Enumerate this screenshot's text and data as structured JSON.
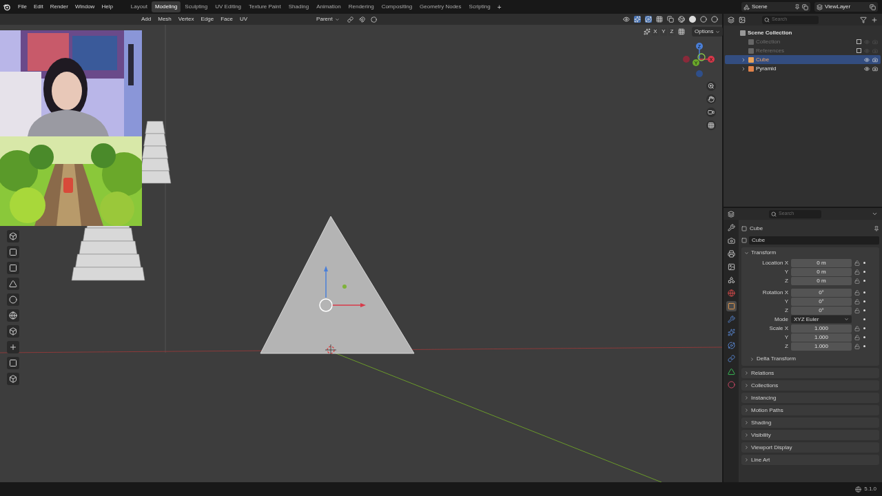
{
  "menu": [
    "File",
    "Edit",
    "Render",
    "Window",
    "Help"
  ],
  "workspaces": [
    {
      "label": "Layout",
      "selected": false
    },
    {
      "label": "Modeling",
      "selected": true
    },
    {
      "label": "Sculpting",
      "selected": false
    },
    {
      "label": "UV Editing",
      "selected": false
    },
    {
      "label": "Texture Paint",
      "selected": false
    },
    {
      "label": "Shading",
      "selected": false
    },
    {
      "label": "Animation",
      "selected": false
    },
    {
      "label": "Rendering",
      "selected": false
    },
    {
      "label": "Compositing",
      "selected": false
    },
    {
      "label": "Geometry Nodes",
      "selected": false
    },
    {
      "label": "Scripting",
      "selected": false
    }
  ],
  "add_workspace": "+",
  "scene": "Scene",
  "view_layer": "ViewLayer",
  "viewport": {
    "menus": [
      "Add",
      "Mesh",
      "Vertex",
      "Edge",
      "Face",
      "UV"
    ],
    "pivot": "Parent",
    "axes": [
      "X",
      "Y",
      "Z"
    ],
    "options": "Options",
    "gizmo_labels": [
      "Z",
      "Y",
      "X"
    ]
  },
  "outliner": {
    "search_placeholder": "Search",
    "items": [
      {
        "label": "Scene Collection",
        "selected": false,
        "children": [
          {
            "label": "Collection",
            "selected": false,
            "excluded": true
          },
          {
            "label": "References",
            "selected": false,
            "excluded": true
          },
          {
            "label": "Cube",
            "selected": true,
            "excluded": false,
            "expanded": false,
            "color": "#e8a35a"
          },
          {
            "label": "Pyramid",
            "selected": false,
            "excluded": false,
            "expanded": false,
            "color": "#e0824a"
          }
        ]
      }
    ]
  },
  "properties": {
    "search_placeholder": "Search",
    "object_name": "Cube",
    "data_name": "Cube",
    "tabs": [
      {
        "kind": "tool",
        "selected": false
      },
      {
        "kind": "render",
        "selected": false
      },
      {
        "kind": "output",
        "selected": false
      },
      {
        "kind": "view_layer",
        "selected": false
      },
      {
        "kind": "scene",
        "selected": false
      },
      {
        "kind": "world",
        "selected": false
      },
      {
        "kind": "object",
        "selected": true
      },
      {
        "kind": "modifier",
        "selected": false
      },
      {
        "kind": "particles",
        "selected": false
      },
      {
        "kind": "physics",
        "selected": false
      },
      {
        "kind": "constraints",
        "selected": false
      },
      {
        "kind": "data",
        "selected": false
      },
      {
        "kind": "material",
        "selected": false
      }
    ],
    "transform": {
      "title": "Transform",
      "expanded": true,
      "rows": [
        {
          "kind": "number",
          "label": "Location X",
          "value": "0 m"
        },
        {
          "kind": "number",
          "label": "Y",
          "value": "0 m"
        },
        {
          "kind": "number",
          "label": "Z",
          "value": "0 m"
        },
        {
          "kind": "gap"
        },
        {
          "kind": "number",
          "label": "Rotation X",
          "value": "0°"
        },
        {
          "kind": "number",
          "label": "Y",
          "value": "0°"
        },
        {
          "kind": "number",
          "label": "Z",
          "value": "0°"
        },
        {
          "kind": "select",
          "label": "Mode",
          "value": "XYZ Euler"
        },
        {
          "kind": "number",
          "label": "Scale X",
          "value": "1.000"
        },
        {
          "kind": "number",
          "label": "Y",
          "value": "1.000"
        },
        {
          "kind": "number",
          "label": "Z",
          "value": "1.000"
        }
      ],
      "subpanel": {
        "title": "Delta Transform",
        "expanded": false
      }
    },
    "panels": [
      {
        "title": "Relations",
        "expanded": false
      },
      {
        "title": "Collections",
        "expanded": false
      },
      {
        "title": "Instancing",
        "expanded": false
      },
      {
        "title": "Motion Paths",
        "expanded": false
      },
      {
        "title": "Shading",
        "expanded": false
      },
      {
        "title": "Visibility",
        "expanded": false
      },
      {
        "title": "Viewport Display",
        "expanded": false
      },
      {
        "title": "Line Art",
        "expanded": false
      }
    ]
  },
  "status": {
    "version": "5.1.0"
  }
}
